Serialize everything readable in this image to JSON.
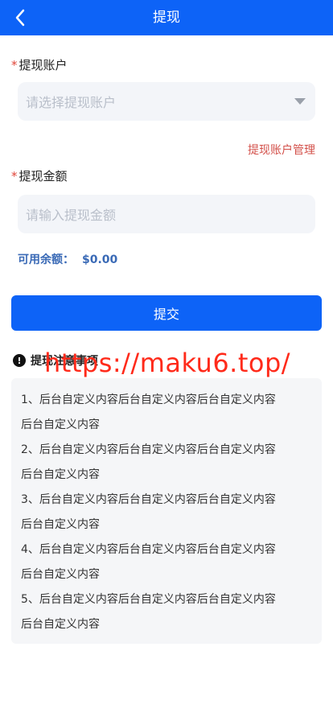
{
  "header": {
    "title": "提现"
  },
  "account": {
    "label": "提现账户",
    "placeholder": "请选择提现账户",
    "manage_link": "提现账户管理"
  },
  "amount": {
    "label": "提现金额",
    "placeholder": "请输入提现金额"
  },
  "balance": {
    "label": "可用余额：",
    "value": "$0.00"
  },
  "submit_label": "提交",
  "notice": {
    "title": "提现注意事项",
    "lines": [
      "1、后台自定义内容后台自定义内容后台自定义内容",
      "后台自定义内容",
      "2、后台自定义内容后台自定义内容后台自定义内容",
      "后台自定义内容",
      "3、后台自定义内容后台自定义内容后台自定义内容",
      "后台自定义内容",
      "4、后台自定义内容后台自定义内容后台自定义内容",
      "后台自定义内容",
      "5、后台自定义内容后台自定义内容后台自定义内容",
      "后台自定义内容"
    ]
  },
  "watermark": "https://maku6.top/",
  "colors": {
    "primary": "#0d63f7",
    "required": "#e0463a",
    "link": "#d3504a",
    "balance": "#3a6ab6",
    "watermark": "#ff2a1a"
  }
}
